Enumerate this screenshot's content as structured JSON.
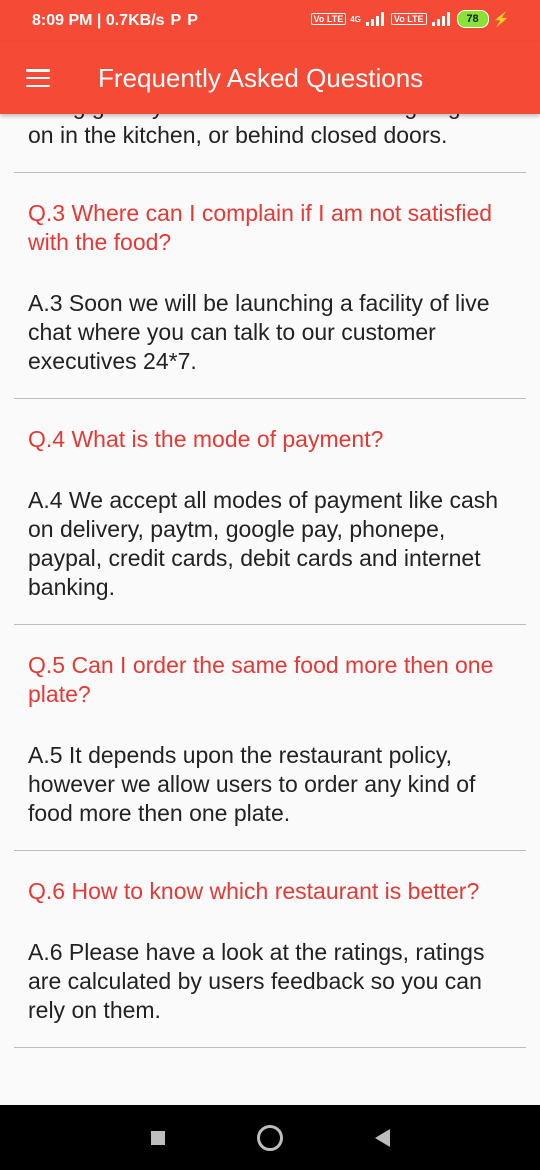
{
  "status_bar": {
    "time_speed": "8:09 PM | 0.7KB/s",
    "notif_icons": [
      "P",
      "P"
    ],
    "network_label_1": "Vo LTE",
    "network_label_4g": "4G",
    "network_label_2": "Vo LTE",
    "battery": "78"
  },
  "app_bar": {
    "title": "Frequently Asked Questions"
  },
  "faq": {
    "partial_top": "rating gives you some idea of what's going",
    "partial_bottom": "on in the kitchen, or behind closed doors.",
    "items": [
      {
        "question": "Q.3 Where can I complain if I am not satisfied with the food?",
        "answer": "A.3 Soon we will be launching a facility of live chat where you can talk to our customer executives 24*7."
      },
      {
        "question": "Q.4 What is the mode of payment?",
        "answer": "A.4 We accept all modes of payment like cash on delivery, paytm, google pay, phonepe, paypal, credit cards, debit cards and internet banking."
      },
      {
        "question": "Q.5 Can I order the same food more then one plate?",
        "answer": "A.5 It depends upon the restaurant policy, however we allow users to order any kind of food more then one plate."
      },
      {
        "question": "Q.6 How to know which restaurant is better?",
        "answer": "A.6 Please have a look at the ratings, ratings are calculated by users feedback so you can rely on them."
      }
    ]
  },
  "colors": {
    "primary": "#f44a36",
    "question": "#e53935",
    "divider": "#bdbdbd"
  }
}
